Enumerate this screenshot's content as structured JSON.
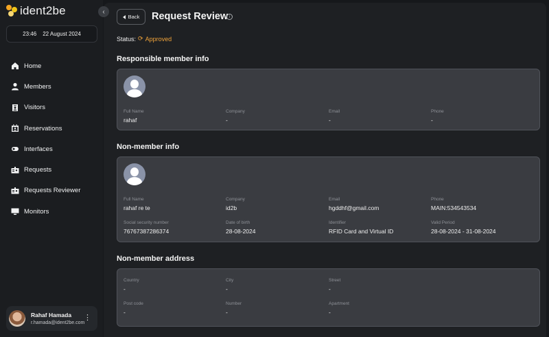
{
  "app": {
    "logo_text": "ident2be"
  },
  "sidebar": {
    "time": "23:46",
    "date": "22 August 2024",
    "items": [
      {
        "label": "Home",
        "icon": "home-icon"
      },
      {
        "label": "Members",
        "icon": "person-icon"
      },
      {
        "label": "Visitors",
        "icon": "badge-icon"
      },
      {
        "label": "Reservations",
        "icon": "calendar-user-icon"
      },
      {
        "label": "Interfaces",
        "icon": "toggle-icon"
      },
      {
        "label": "Requests",
        "icon": "id-card-icon"
      },
      {
        "label": "Requests Reviewer",
        "icon": "id-card-icon"
      },
      {
        "label": "Monitors",
        "icon": "monitor-icon"
      }
    ],
    "user": {
      "name": "Rahaf Hamada",
      "email": "r.hamada@ident2be.com"
    }
  },
  "header": {
    "back_label": "Back",
    "title": "Request Review",
    "status_label": "Status:",
    "status_value": "Approved",
    "status_color": "#f0a33a"
  },
  "responsible": {
    "title": "Responsible member info",
    "fields": [
      {
        "label": "Full Name",
        "value": "rahaf"
      },
      {
        "label": "Company",
        "value": "-"
      },
      {
        "label": "Email",
        "value": "-"
      },
      {
        "label": "Phone",
        "value": "-"
      }
    ]
  },
  "nonmember": {
    "title": "Non-member info",
    "fields": [
      {
        "label": "Full Name",
        "value": "rahaf re te"
      },
      {
        "label": "Company",
        "value": "id2b"
      },
      {
        "label": "Email",
        "value": "hgddhf@gmail.com"
      },
      {
        "label": "Phone",
        "value": "MAIN:534543534"
      },
      {
        "label": "Social security number",
        "value": "76767387286374"
      },
      {
        "label": "Date of birth",
        "value": "28-08-2024"
      },
      {
        "label": "Identifier",
        "value": "RFID Card and Virtual ID"
      },
      {
        "label": "Valid Period",
        "value": "28-08-2024 - 31-08-2024"
      }
    ]
  },
  "address": {
    "title": "Non-member address",
    "fields": [
      {
        "label": "Country",
        "value": "-"
      },
      {
        "label": "City",
        "value": "-"
      },
      {
        "label": "Street",
        "value": "-"
      },
      {
        "label": "Post code",
        "value": "-"
      },
      {
        "label": "Number",
        "value": "-"
      },
      {
        "label": "Apartment",
        "value": "-"
      }
    ]
  }
}
